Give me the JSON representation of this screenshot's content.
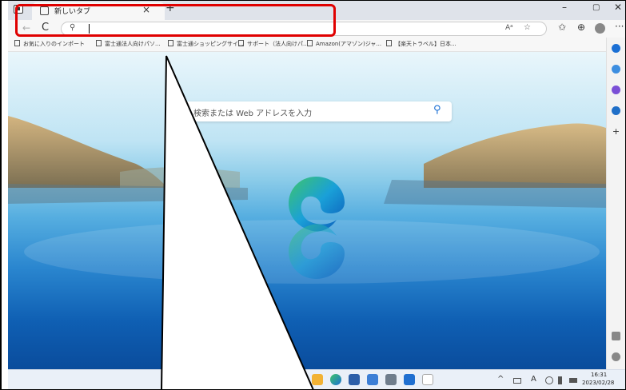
{
  "tab": {
    "title": "新しいタブ",
    "close": "×",
    "new_tab": "+"
  },
  "window": {
    "minimize": "–",
    "maximize": "▢",
    "close": "✕"
  },
  "toolbar": {
    "back": "←",
    "refresh": "C",
    "address_value": "",
    "read_aloud": "Aᵃ",
    "add_favorite": "☆",
    "favorites": "✩",
    "collections": "⊕",
    "more": "···"
  },
  "favorites_bar": [
    {
      "label": "お気に入りのインポート"
    },
    {
      "label": "富士通法人向けパソ..."
    },
    {
      "label": "富士通ショッピングサイ..."
    },
    {
      "label": "サポート（法人向けパ..."
    },
    {
      "label": "Amazon(アマゾン)ジャ..."
    },
    {
      "label": "【楽天トラベル】日本..."
    }
  ],
  "search": {
    "placeholder": "検索または Web アドレスを入力",
    "icon": "⚲"
  },
  "taskbar": {
    "tray_chevron": "^",
    "tray_lang": "A",
    "clock_time": "16:31",
    "clock_date": "2023/02/28"
  },
  "colors": {
    "highlight": "#e00000",
    "edge_blue": "#1a6fd4",
    "edge_green": "#3ec56a"
  }
}
